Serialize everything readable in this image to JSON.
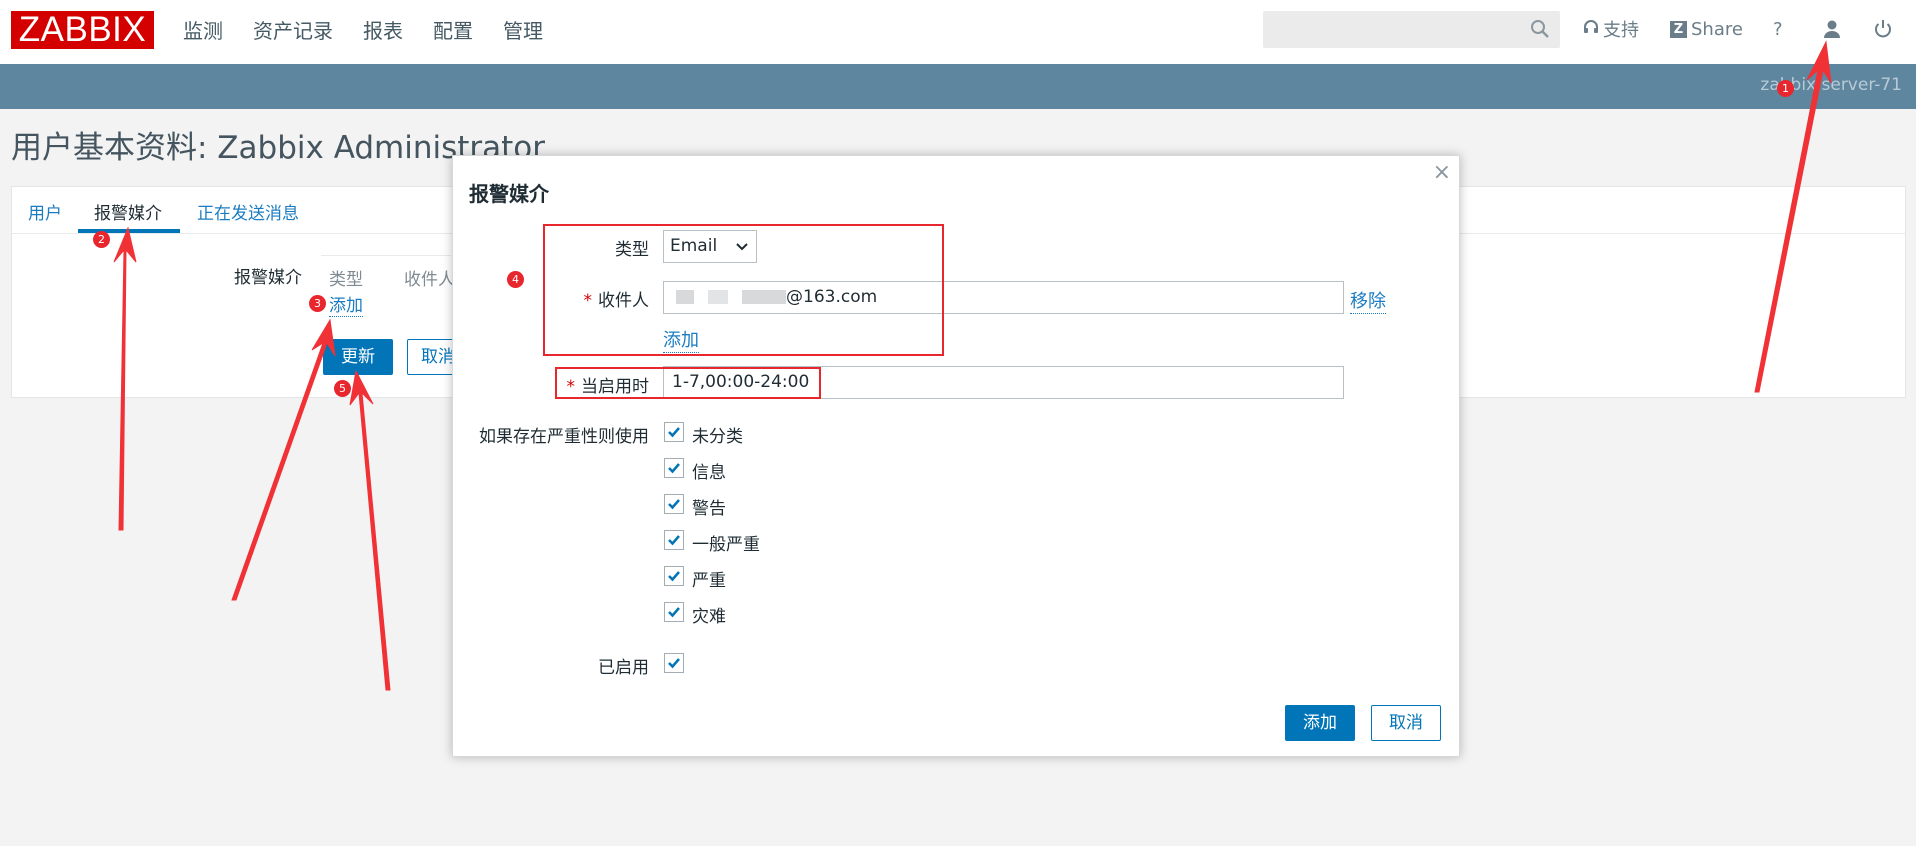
{
  "app": {
    "logo": "ZABBIX",
    "brand_color": "#d40000",
    "accent_color": "#0275b8",
    "annotation_color": "#e8262d"
  },
  "menu": [
    "监测",
    "资产记录",
    "报表",
    "配置",
    "管理"
  ],
  "toplinks": {
    "support": "支持",
    "share": "Share",
    "help": "?"
  },
  "search": {
    "value": ""
  },
  "statusbar": {
    "server": "zabbix server-71"
  },
  "page": {
    "title": "用户基本资料: Zabbix Administrator"
  },
  "tabs": [
    {
      "label": "用户",
      "active": false
    },
    {
      "label": "报警媒介",
      "active": true
    },
    {
      "label": "正在发送消息",
      "active": false
    }
  ],
  "media_form": {
    "label": "报警媒介",
    "columns": [
      "类型",
      "收件人"
    ],
    "add_link": "添加",
    "update_button": "更新",
    "cancel_button": "取消"
  },
  "dialog": {
    "title": "报警媒介",
    "close": "×",
    "type_label": "类型",
    "type_value": "Email",
    "recipient_label": "收件人",
    "recipient_value": "@163.com",
    "recipient_blurred_prefix": true,
    "remove_link": "移除",
    "add_link": "添加",
    "when_active_label": "当启用时",
    "when_active_value": "1-7,00:00-24:00",
    "severity_label": "如果存在严重性则使用",
    "severities": [
      {
        "label": "未分类",
        "checked": true
      },
      {
        "label": "信息",
        "checked": true
      },
      {
        "label": "警告",
        "checked": true
      },
      {
        "label": "一般严重",
        "checked": true
      },
      {
        "label": "严重",
        "checked": true
      },
      {
        "label": "灾难",
        "checked": true
      }
    ],
    "enabled_label": "已启用",
    "enabled": true,
    "add_button": "添加",
    "cancel_button": "取消"
  },
  "annotations": [
    "1",
    "2",
    "3",
    "4",
    "5"
  ]
}
